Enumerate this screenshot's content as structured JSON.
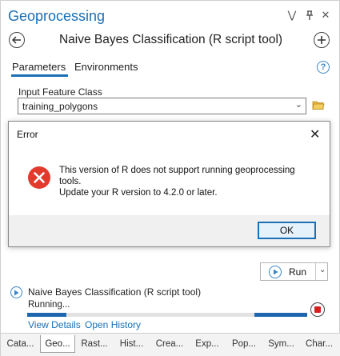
{
  "pane": {
    "title": "Geoprocessing",
    "pin_glyph": "↕",
    "float_glyph": "⋁",
    "close_glyph": "✕"
  },
  "tool": {
    "title": "Naive Bayes Classification (R script tool)",
    "back_icon": "back-arrow-icon",
    "add_icon": "add-icon"
  },
  "tabs": {
    "parameters": "Parameters",
    "environments": "Environments",
    "help_glyph": "?"
  },
  "input": {
    "label": "Input Feature Class",
    "value": "training_polygons",
    "chevron": "⌄"
  },
  "dialog": {
    "title": "Error",
    "close_glyph": "✕",
    "message_line1": "This version of R does not support running geoprocessing",
    "message_line2": "tools.",
    "message_line3": "Update your R version to 4.2.0 or later.",
    "ok_label": "OK"
  },
  "run": {
    "label": "Run",
    "chevron": "⌄"
  },
  "status": {
    "tool_name": "Naive Bayes Classification (R script tool)",
    "state": "Running...",
    "progress_segments": [
      {
        "start": 0.0,
        "end": 0.14
      },
      {
        "start": 0.81,
        "end": 1.0
      }
    ],
    "view_details": "View Details",
    "open_history": "Open History"
  },
  "bottom_tabs": [
    {
      "label": "Cata...",
      "active": false
    },
    {
      "label": "Geo...",
      "active": true
    },
    {
      "label": "Rast...",
      "active": false
    },
    {
      "label": "Hist...",
      "active": false
    },
    {
      "label": "Crea...",
      "active": false
    },
    {
      "label": "Exp...",
      "active": false
    },
    {
      "label": "Pop...",
      "active": false
    },
    {
      "label": "Sym...",
      "active": false
    },
    {
      "label": "Char...",
      "active": false
    }
  ],
  "colors": {
    "accent": "#1a6fb5",
    "error_red": "#e23b2e",
    "stop_red": "#d62020"
  }
}
